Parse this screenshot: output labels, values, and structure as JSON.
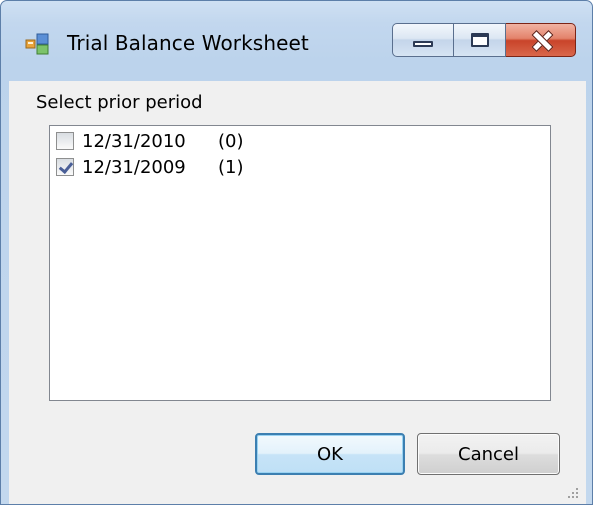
{
  "window": {
    "title": "Trial Balance Worksheet",
    "icon": "app-window-icon"
  },
  "caption_buttons": {
    "minimize_icon": "minimize-icon",
    "maximize_icon": "maximize-icon",
    "close_icon": "close-icon"
  },
  "period_selector": {
    "label": "Select prior period",
    "items": [
      {
        "date": "12/31/2010",
        "count": "(0)",
        "checked": false
      },
      {
        "date": "12/31/2009",
        "count": "(1)",
        "checked": true
      }
    ]
  },
  "buttons": {
    "ok_label": "OK",
    "cancel_label": "Cancel"
  },
  "colors": {
    "accent": "#3c7fb1",
    "close_red": "#c9442a",
    "window_frame": "#c2d7ee"
  }
}
